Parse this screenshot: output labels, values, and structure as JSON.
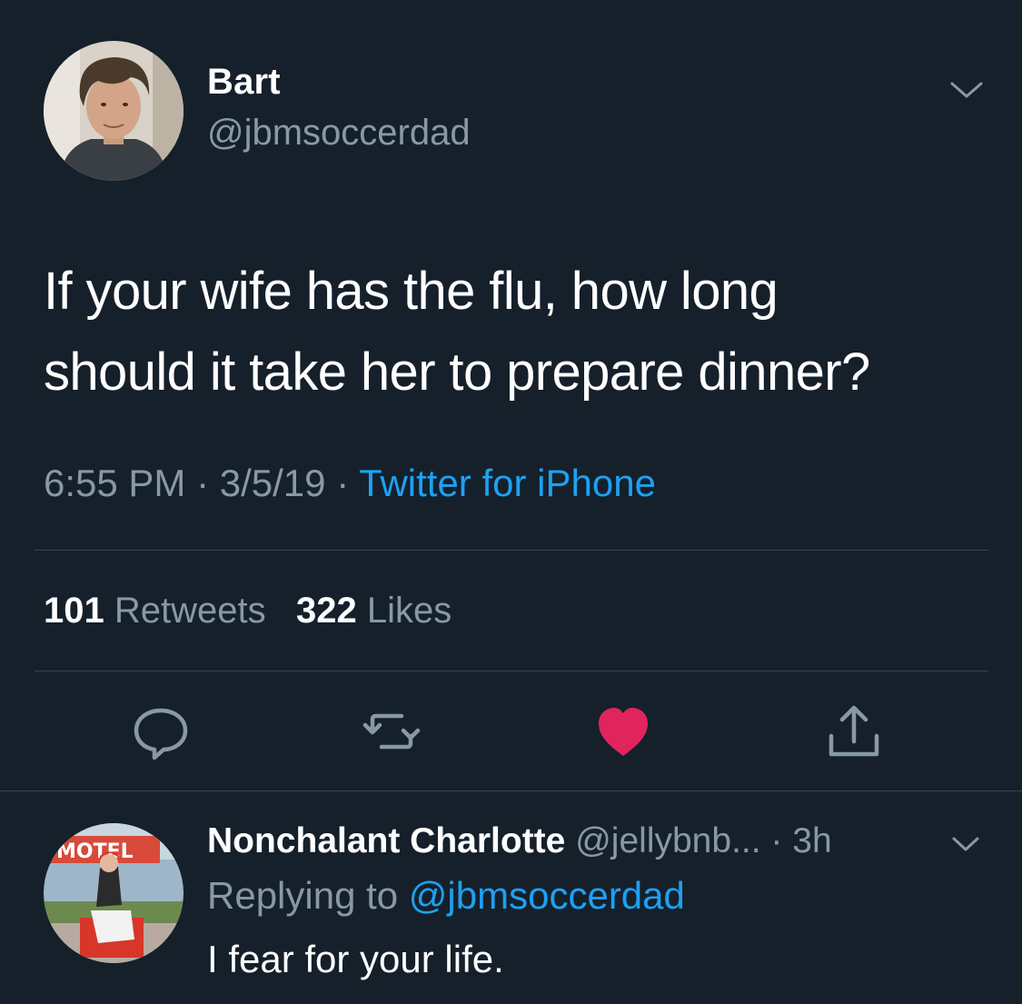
{
  "tweet": {
    "author": {
      "name": "Bart",
      "handle": "@jbmsoccerdad",
      "avatar": "avatar-photo"
    },
    "text_line1": "If your wife has the flu, how long",
    "text_line2": "should it take her to prepare dinner?",
    "time": "6:55 PM",
    "date": "3/5/19",
    "separator": " · ",
    "source": "Twitter for iPhone",
    "retweets_count": "101",
    "retweets_label": "Retweets",
    "likes_count": "322",
    "likes_label": "Likes",
    "actions": [
      "reply-icon",
      "retweet-icon",
      "like-icon",
      "share-icon"
    ],
    "liked": true
  },
  "reply": {
    "name": "Nonchalant Charlotte",
    "handle": "@jellybnb...",
    "age": "3h",
    "replying_label": "Replying to",
    "replying_to": "@jbmsoccerdad",
    "text": "I fear for your life.",
    "avatar_sign_text": "MOTEL"
  },
  "colors": {
    "background": "#15202b",
    "primary_text": "#ffffff",
    "secondary_text": "#8899a6",
    "link": "#1da1f2",
    "like": "#e0245e",
    "divider": "#38444d"
  }
}
